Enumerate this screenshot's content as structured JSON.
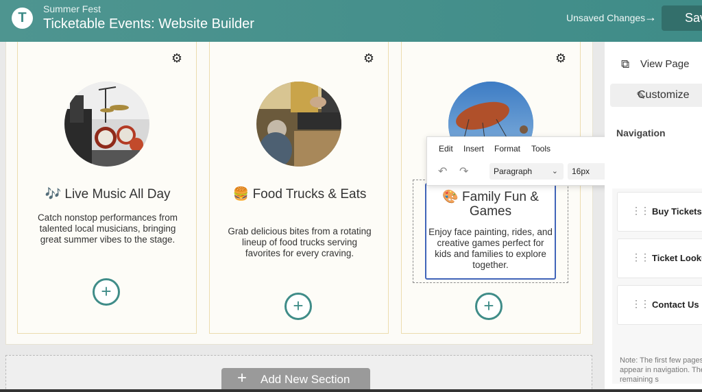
{
  "header": {
    "logo_letter": "T",
    "event_name": "Summer Fest",
    "app_title": "Ticketable Events: Website Builder",
    "unsaved_label": "Unsaved Changes",
    "save_label": "Save"
  },
  "cards": [
    {
      "emoji": "🎶",
      "title": "Live Music All Day",
      "description": "Catch nonstop performances from talented local musicians, bringing great summer vibes to the stage.",
      "photo": "drum-kit-stage-photo"
    },
    {
      "emoji": "🍔",
      "title": "Food Trucks & Eats",
      "description": "Grab delicious bites from a rotating lineup of food trucks serving favorites for every craving.",
      "photo": "food-truck-chef-photo"
    },
    {
      "emoji": "🎨",
      "title": "Family Fun & Games",
      "description": "Enjoy face painting, rides, and creative games perfect for kids and families to explore together.",
      "photo": "swing-ride-photo"
    }
  ],
  "editor_toolbar": {
    "menus": [
      "Edit",
      "Insert",
      "Format",
      "Tools"
    ],
    "block_format": "Paragraph",
    "font_size": "16px",
    "icons": [
      "undo-icon",
      "redo-icon",
      "line-height-icon",
      "link-icon"
    ]
  },
  "right_panel": {
    "view_page_label": "View Page",
    "customize_label": "Customize",
    "navigation_heading": "Navigation",
    "nav_items": [
      "Buy Tickets",
      "Ticket Lookup",
      "Contact Us"
    ],
    "note": "Note: The first few pages appear in navigation. The remaining s"
  },
  "add_section_label": "Add New Section",
  "colors": {
    "brand_teal": "#3f8c88",
    "editor_border": "#3f63b8"
  }
}
